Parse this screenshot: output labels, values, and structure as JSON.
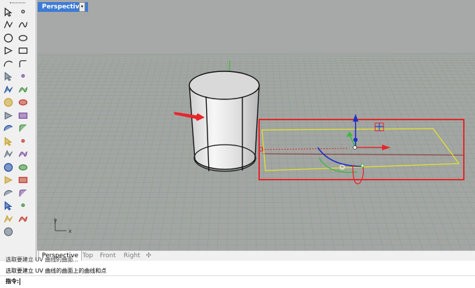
{
  "viewport": {
    "title": "Perspective",
    "menu_arrow": "▾",
    "axis_y": "y",
    "axis_x": "x"
  },
  "tabs": [
    {
      "label": "Perspective",
      "active": true
    },
    {
      "label": "Top",
      "active": false
    },
    {
      "label": "Front",
      "active": false
    },
    {
      "label": "Right",
      "active": false
    },
    {
      "label": "✣",
      "active": false
    }
  ],
  "command": {
    "history_1": "选取要建立 UV 曲线的曲面...",
    "history_2": "选取要建立 UV 曲线的曲面上的曲线和点",
    "prompt": "指令:",
    "input_value": ""
  },
  "toolbar_icons": [
    "select-arrow-icon",
    "point-icon",
    "polyline-icon",
    "curve-icon",
    "circle-icon",
    "ellipse-icon",
    "polygon-icon",
    "rectangle-icon",
    "arc-icon",
    "fillet-icon",
    "loft-icon",
    "extrude-icon",
    "box-icon",
    "sphere-icon",
    "cylinder-icon",
    "plane-icon",
    "boolean-icon",
    "explode-icon",
    "join-icon",
    "trim-icon",
    "split-icon",
    "move-icon",
    "text-icon",
    "dimension-icon",
    "transform-icon",
    "array-icon",
    "mesh-icon",
    "hatch-icon",
    "grid-icon",
    "layer-icon",
    "analyze-icon",
    "render-icon",
    "check-icon",
    "material-icon",
    "paint-icon"
  ],
  "colors": {
    "viewport_bg": "#a6a8a8",
    "grid_line": "#8fa08f",
    "selection_box": "#e8242b",
    "surface_outline": "#e7e02a",
    "active_tab": "#3e7bd4"
  }
}
